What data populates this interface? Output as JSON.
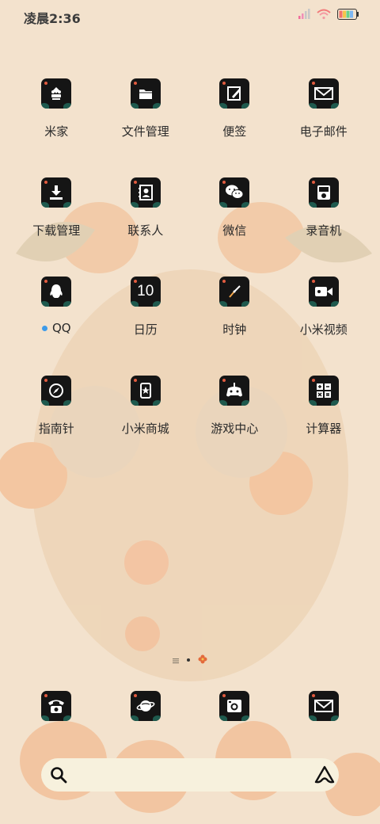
{
  "status_bar": {
    "time": "凌晨2:36"
  },
  "grid_apps": [
    [
      {
        "label": "米家",
        "icon": "mijia-icon"
      },
      {
        "label": "文件管理",
        "icon": "folder-icon"
      },
      {
        "label": "便签",
        "icon": "notes-icon"
      },
      {
        "label": "电子邮件",
        "icon": "mail-icon"
      }
    ],
    [
      {
        "label": "下载管理",
        "icon": "download-icon"
      },
      {
        "label": "联系人",
        "icon": "contacts-icon"
      },
      {
        "label": "微信",
        "icon": "wechat-icon"
      },
      {
        "label": "录音机",
        "icon": "recorder-icon"
      }
    ],
    [
      {
        "label": "QQ",
        "icon": "qq-icon"
      },
      {
        "label": "日历",
        "icon": "calendar-icon",
        "icon_text": "10"
      },
      {
        "label": "时钟",
        "icon": "clock-icon"
      },
      {
        "label": "小米视频",
        "icon": "video-icon"
      }
    ],
    [
      {
        "label": "指南针",
        "icon": "compass-icon"
      },
      {
        "label": "小米商城",
        "icon": "mall-icon"
      },
      {
        "label": "游戏中心",
        "icon": "game-icon"
      },
      {
        "label": "计算器",
        "icon": "calculator-icon"
      }
    ]
  ],
  "dock_apps": [
    {
      "icon": "phone-icon"
    },
    {
      "icon": "browser-icon"
    },
    {
      "icon": "camera-icon"
    },
    {
      "icon": "messages-icon"
    }
  ],
  "search": {
    "icon": "search-icon",
    "assistant_icon": "assistant-icon"
  },
  "colors": {
    "background": "#f3e2cd",
    "icon_bg": "#151515",
    "accent": "#e25b3f",
    "badge": "#3d9be9"
  }
}
